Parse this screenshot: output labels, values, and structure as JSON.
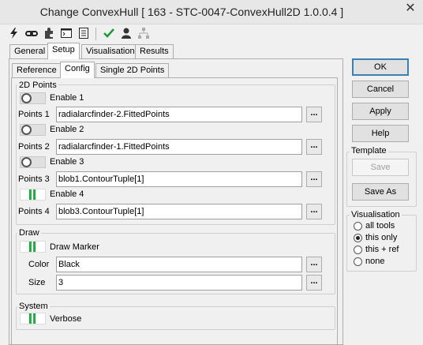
{
  "window": {
    "title": "Change ConvexHull [ 163 - STC-0047-ConvexHull2D 1.0.0.4 ]",
    "close_glyph": "✕"
  },
  "toolbar": {
    "icons": [
      "lightning-icon",
      "link-icon",
      "puzzle-icon",
      "console-icon",
      "list-icon",
      "check-icon",
      "user-icon",
      "network-icon"
    ]
  },
  "tabs": {
    "general": "General",
    "setup": "Setup",
    "visualisation": "Visualisation",
    "results": "Results"
  },
  "subtabs": {
    "reference": "Reference",
    "config": "Config",
    "single_points": "Single 2D Points"
  },
  "points2d": {
    "label": "2D Points",
    "rows": [
      {
        "enable_label": "Enable 1",
        "enabled": false,
        "points_label": "Points 1",
        "value": "radialarcfinder-2.FittedPoints"
      },
      {
        "enable_label": "Enable 2",
        "enabled": false,
        "points_label": "Points 2",
        "value": "radialarcfinder-1.FittedPoints"
      },
      {
        "enable_label": "Enable 3",
        "enabled": false,
        "points_label": "Points 3",
        "value": "blob1.ContourTuple[1]"
      },
      {
        "enable_label": "Enable 4",
        "enabled": true,
        "points_label": "Points 4",
        "value": "blob3.ContourTuple[1]"
      }
    ],
    "browse_label": "..."
  },
  "draw": {
    "label": "Draw",
    "marker_label": "Draw Marker",
    "marker_enabled": true,
    "color_label": "Color",
    "color_value": "Black",
    "size_label": "Size",
    "size_value": "3"
  },
  "system": {
    "label": "System",
    "verbose_label": "Verbose",
    "verbose_enabled": true
  },
  "buttons": {
    "ok": "OK",
    "cancel": "Cancel",
    "apply": "Apply",
    "help": "Help"
  },
  "template": {
    "label": "Template",
    "save": "Save",
    "save_as": "Save As"
  },
  "visualisation": {
    "label": "Visualisation",
    "options": [
      "all tools",
      "this only",
      "this + ref",
      "none"
    ],
    "selected": "this only"
  }
}
